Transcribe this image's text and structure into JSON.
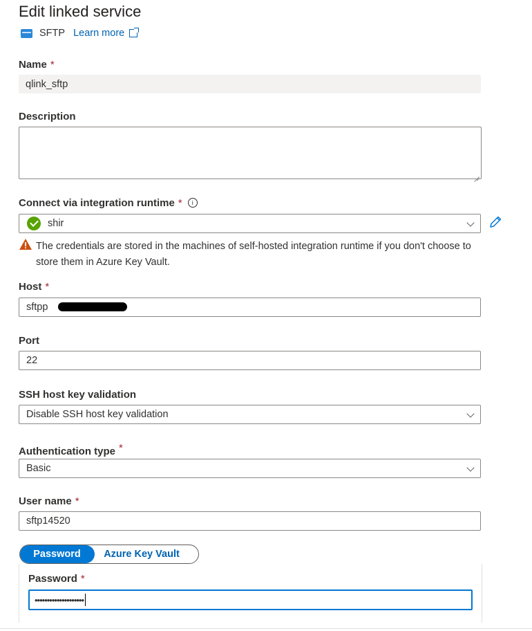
{
  "header": {
    "title": "Edit linked service",
    "connector_name": "SFTP",
    "learn_more": "Learn more"
  },
  "name": {
    "label": "Name",
    "required_mark": "*",
    "value": "qlink_sftp"
  },
  "description": {
    "label": "Description",
    "value": ""
  },
  "runtime": {
    "label": "Connect via integration runtime",
    "required_mark": "*",
    "info_icon": "info-icon",
    "selected": "shir",
    "status_icon": "check-circle-icon",
    "status_color": "#57a300",
    "warning": "The credentials are stored in the machines of self-hosted integration runtime if you don't choose to store them in Azure Key Vault."
  },
  "host": {
    "label": "Host",
    "required_mark": "*",
    "value": "sftpp"
  },
  "port": {
    "label": "Port",
    "value": "22"
  },
  "ssh_validation": {
    "label": "SSH host key validation",
    "selected": "Disable SSH host key validation"
  },
  "auth_type": {
    "label": "Authentication type",
    "required_mark": "*",
    "selected": "Basic"
  },
  "user_name": {
    "label": "User name",
    "required_mark": "*",
    "value": "sftp14520"
  },
  "password_source": {
    "active": "Password",
    "inactive": "Azure Key Vault",
    "accent": "#0078d4"
  },
  "password": {
    "label": "Password",
    "required_mark": "*",
    "masked_value": "••••••••••••••••••••"
  }
}
